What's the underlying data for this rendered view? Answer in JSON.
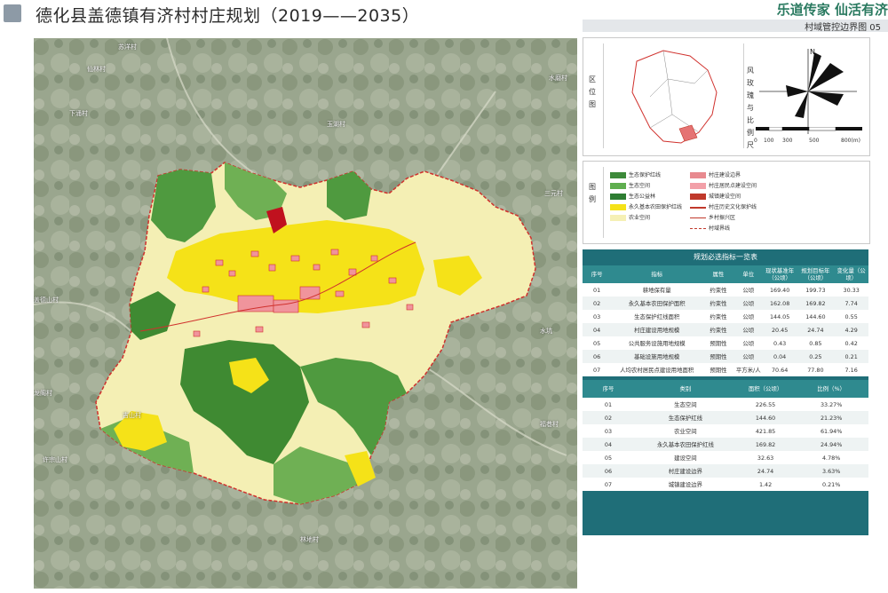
{
  "header": {
    "title": "德化县盖德镇有济村村庄规划（2019——2035）",
    "slogan": "乐道传家  仙活有济",
    "map_name": "村域管控边界图 05"
  },
  "map": {
    "place_labels": [
      "苏洋村",
      "水磨村",
      "下涌村",
      "玉湖村",
      "盖德山村",
      "三元村",
      "龙阁村",
      "吉山村",
      "福巷村",
      "林地村",
      "仙林村",
      "水坑",
      "许宗山村"
    ]
  },
  "location_panel": {
    "label": "区位图",
    "compass_label": "风玫瑰与比例尺",
    "north": "N",
    "scale_ticks": [
      "0",
      "100",
      "300",
      "500",
      "800(m)"
    ]
  },
  "legend": {
    "label": "图例",
    "items": [
      {
        "label": "生态保护红线",
        "color": "#3d8a3a",
        "kind": "fill"
      },
      {
        "label": "村庄建设边界",
        "color": "#e88a8f",
        "kind": "fill"
      },
      {
        "label": "生态空间",
        "color": "#5fae4f",
        "kind": "fill"
      },
      {
        "label": "村庄居民点建设空间",
        "color": "#f2a0a8",
        "kind": "fill"
      },
      {
        "label": "生态公益林",
        "color": "#2e7d32",
        "kind": "fill"
      },
      {
        "label": "城镇建设空间",
        "color": "#c0392b",
        "kind": "fill"
      },
      {
        "label": "永久基本农田保护红线",
        "color": "#f5e218",
        "kind": "fill"
      },
      {
        "label": "村庄历史文化保护线",
        "color": "#c0392b",
        "kind": "line"
      },
      {
        "label": "农业空间",
        "color": "#f5f0b5",
        "kind": "fill"
      },
      {
        "label": "乡村振兴区",
        "color": "#c0392b",
        "kind": "thin"
      },
      {
        "label": "",
        "color": "#ffffff",
        "kind": "none"
      },
      {
        "label": "村域界线",
        "color": "#c0392b",
        "kind": "dash"
      }
    ]
  },
  "indicator_table": {
    "title": "规划必选指标一览表",
    "headers": [
      "序号",
      "指标",
      "属性",
      "单位",
      "现状基准年（公顷）",
      "规划目标年（公顷）",
      "变化量（公顷）"
    ],
    "rows": [
      [
        "01",
        "耕地保有量",
        "约束性",
        "公顷",
        "169.40",
        "199.73",
        "30.33"
      ],
      [
        "02",
        "永久基本农田保护面积",
        "约束性",
        "公顷",
        "162.08",
        "169.82",
        "7.74"
      ],
      [
        "03",
        "生态保护红线面积",
        "约束性",
        "公顷",
        "144.05",
        "144.60",
        "0.55"
      ],
      [
        "04",
        "村庄建设用地规模",
        "约束性",
        "公顷",
        "20.45",
        "24.74",
        "4.29"
      ],
      [
        "05",
        "公共服务设施用地规模",
        "预期性",
        "公顷",
        "0.43",
        "0.85",
        "0.42"
      ],
      [
        "06",
        "基础设施用地规模",
        "预期性",
        "公顷",
        "0.04",
        "0.25",
        "0.21"
      ],
      [
        "07",
        "人均农村居民点建设用地面积",
        "预期性",
        "平方米/人",
        "70.64",
        "77.80",
        "7.16"
      ]
    ]
  },
  "space_table": {
    "headers": [
      "序号",
      "类别",
      "面积（公顷）",
      "比例（%）"
    ],
    "rows": [
      [
        "01",
        "生态空间",
        "226.55",
        "33.27%"
      ],
      [
        "02",
        "生态保护红线",
        "144.60",
        "21.23%"
      ],
      [
        "03",
        "农业空间",
        "421.85",
        "61.94%"
      ],
      [
        "04",
        "永久基本农田保护红线",
        "169.82",
        "24.94%"
      ],
      [
        "05",
        "建设空间",
        "32.63",
        "4.78%"
      ],
      [
        "06",
        "村庄建设边界",
        "24.74",
        "3.63%"
      ],
      [
        "07",
        "城镇建设边界",
        "1.42",
        "0.21%"
      ]
    ]
  }
}
